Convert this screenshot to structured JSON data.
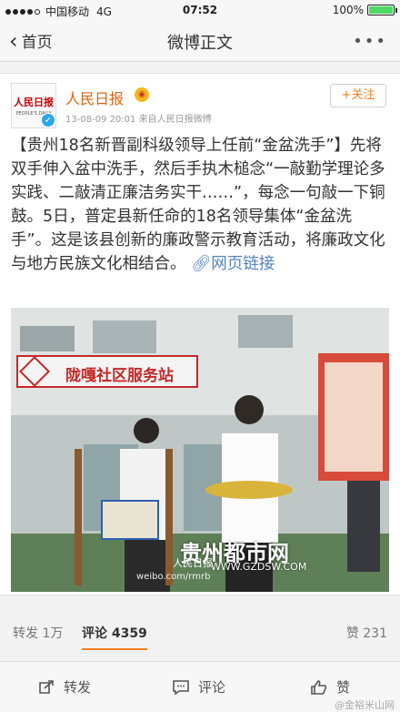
{
  "status_bar": {
    "carrier": "中国移动",
    "network": "4G",
    "time": "07:52",
    "battery": "100%",
    "battery_level": 1.0
  },
  "nav": {
    "back_label": "首页",
    "title": "微博正文"
  },
  "post": {
    "avatar_logo": "人民日报",
    "avatar_sub": "PEOPLE'S DAILY",
    "author": "人民日报",
    "meta": "13-08-09 20:01  来自人民日报微博",
    "follow_label": "+关注",
    "text": "【贵州18名新晋副科级领导上任前“金盆洗手”】先将双手伸入盆中洗手，然后手执木槌念“一敲勤学理论多实践、二敲清正廉洁务实干……”，每念一句敲一下铜鼓。5日，普定县新任命的18名领导集体“金盆洗手”。这是该县创新的廉政警示教育活动，将廉政文化与地方民族文化相结合。",
    "link_label": "网页链接",
    "photo": {
      "sign_text": "陇嘎社区服务站",
      "watermark_cn": "贵州都市网",
      "watermark_url": "WWW.GZDSW.COM",
      "watermark_people": "人民日报",
      "caption": "weibo.com/rmrb"
    }
  },
  "stats": {
    "repost": "转发 1万",
    "comment": "评论 4359",
    "like": "赞 231"
  },
  "actions": {
    "repost": "转发",
    "comment": "评论",
    "like": "赞"
  },
  "footer_watermark": "@金裕米山网"
}
